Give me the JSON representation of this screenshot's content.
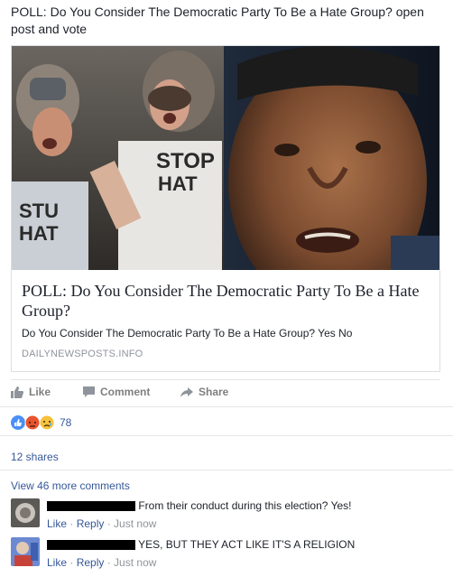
{
  "post": {
    "text": "POLL: Do You Consider The Democratic Party To Be a Hate Group? open post and vote"
  },
  "link_card": {
    "title": "POLL: Do You Consider The Democratic Party To Be a Hate Group?",
    "description": "Do You Consider The Democratic Party To Be a Hate Group? Yes No",
    "domain": "DAILYNEWSPOSTS.INFO",
    "image_signs": [
      "STOP",
      "HAT",
      "STU",
      "HAT"
    ]
  },
  "actions": {
    "like_label": "Like",
    "comment_label": "Comment",
    "share_label": "Share"
  },
  "reactions": {
    "icons": [
      "like-icon",
      "angry-icon",
      "sad-icon"
    ],
    "count": "78"
  },
  "shares": {
    "label": "12 shares"
  },
  "comments": {
    "more_label": "View 46 more comments",
    "items": [
      {
        "text": "From their conduct during this election? Yes!",
        "like": "Like",
        "reply": "Reply",
        "time": "Just now"
      },
      {
        "text": "YES, BUT THEY ACT LIKE IT'S A RELIGION",
        "like": "Like",
        "reply": "Reply",
        "time": "Just now"
      }
    ],
    "separator": " · "
  },
  "colors": {
    "link": "#365899",
    "meta": "#90949c",
    "text": "#1d2129",
    "like_reaction": "#4a8ff7",
    "angry_reaction": "#e9542f",
    "sad_reaction": "#f7c23c"
  }
}
